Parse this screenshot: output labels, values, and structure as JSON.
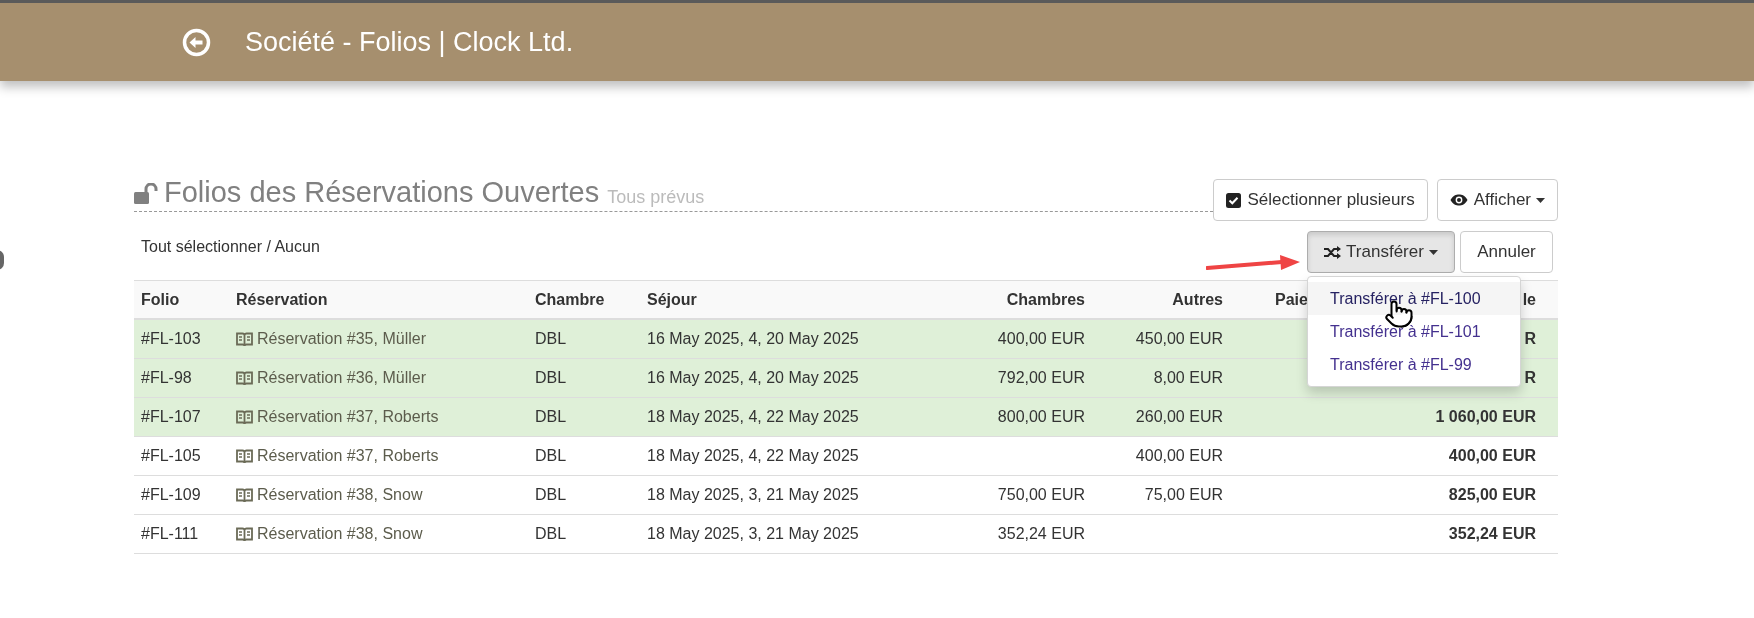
{
  "header": {
    "title": "Société - Folios | Clock Ltd."
  },
  "section": {
    "title": "Folios des Réservations Ouvertes",
    "subtitle": "Tous prévus"
  },
  "select_all": "Tout sélectionner / Aucun",
  "toolbar": [
    {
      "label": "Sélectionner plusieurs",
      "kind": "check",
      "caret": false
    },
    {
      "label": "Afficher",
      "kind": "eye",
      "caret": true
    }
  ],
  "transfer_button": {
    "label": "Transférer",
    "pressed": true
  },
  "cancel_button": {
    "label": "Annuler"
  },
  "transfer_menu": [
    {
      "label": "Transférer à #FL-100",
      "selected": true
    },
    {
      "label": "Transférer à #FL-101",
      "selected": false
    },
    {
      "label": "Transférer à #FL-99",
      "selected": false
    }
  ],
  "table": {
    "columns": [
      "Folio",
      "Réservation",
      "Chambre",
      "Séjour",
      "Chambres",
      "Autres",
      "Paie",
      "le"
    ],
    "rows": [
      {
        "folio": "#FL-103",
        "reservation": "Réservation #35, Müller",
        "room": "DBL",
        "stay": "16 May 2025, 4, 20 May 2025",
        "rooms": "400,00 EUR",
        "others": "450,00 EUR",
        "total": "R",
        "selected": true
      },
      {
        "folio": "#FL-98",
        "reservation": "Réservation #36, Müller",
        "room": "DBL",
        "stay": "16 May 2025, 4, 20 May 2025",
        "rooms": "792,00 EUR",
        "others": "8,00 EUR",
        "total": "R",
        "selected": true
      },
      {
        "folio": "#FL-107",
        "reservation": "Réservation #37, Roberts",
        "room": "DBL",
        "stay": "18 May 2025, 4, 22 May 2025",
        "rooms": "800,00 EUR",
        "others": "260,00 EUR",
        "total": "1 060,00 EUR",
        "selected": true
      },
      {
        "folio": "#FL-105",
        "reservation": "Réservation #37, Roberts",
        "room": "DBL",
        "stay": "18 May 2025, 4, 22 May 2025",
        "rooms": "",
        "others": "400,00 EUR",
        "total": "400,00 EUR",
        "selected": false
      },
      {
        "folio": "#FL-109",
        "reservation": "Réservation #38, Snow",
        "room": "DBL",
        "stay": "18 May 2025, 3, 21 May 2025",
        "rooms": "750,00 EUR",
        "others": "75,00 EUR",
        "total": "825,00 EUR",
        "selected": false
      },
      {
        "folio": "#FL-111",
        "reservation": "Réservation #38, Snow",
        "room": "DBL",
        "stay": "18 May 2025, 3, 21 May 2025",
        "rooms": "352,24 EUR",
        "others": "",
        "total": "352,24 EUR",
        "selected": false
      }
    ]
  }
}
